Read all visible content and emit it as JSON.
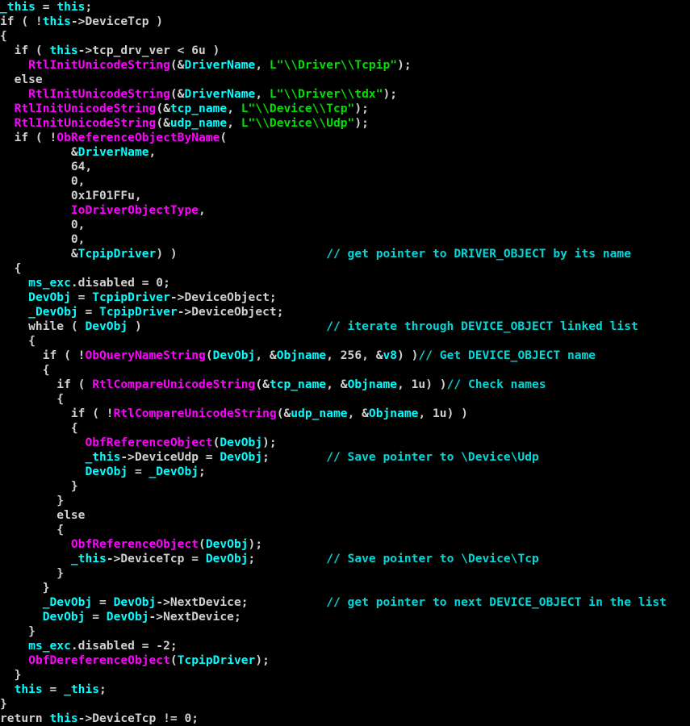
{
  "app": {
    "view_name": "Pseudocode",
    "background_color": "#000000"
  },
  "theme": {
    "background": "#000000",
    "default_text": "#d0d0d0",
    "keyword": "#d0d0d0",
    "identifier": "#00ffff",
    "function": "#ff00ff",
    "string": "#00e000",
    "comment": "#00d8d8",
    "number": "#d0d0d0"
  },
  "code": {
    "language": "c-pseudocode",
    "lines": [
      {
        "tokens": [
          {
            "t": "_this",
            "c": "var"
          },
          {
            "t": " ",
            "c": "plain"
          },
          {
            "t": "=",
            "c": "plain"
          },
          {
            "t": " ",
            "c": "plain"
          },
          {
            "t": "this",
            "c": "this"
          },
          {
            "t": ";",
            "c": "punct"
          }
        ]
      },
      {
        "tokens": [
          {
            "t": "if ( !",
            "c": "plain"
          },
          {
            "t": "this",
            "c": "this"
          },
          {
            "t": "->DeviceTcp )",
            "c": "plain"
          }
        ]
      },
      {
        "tokens": [
          {
            "t": "{",
            "c": "punct"
          }
        ]
      },
      {
        "tokens": [
          {
            "t": "  if ( ",
            "c": "plain"
          },
          {
            "t": "this",
            "c": "this"
          },
          {
            "t": "->tcp_drv_ver < 6u )",
            "c": "plain"
          }
        ]
      },
      {
        "tokens": [
          {
            "t": "    ",
            "c": "plain"
          },
          {
            "t": "RtlInitUnicodeString",
            "c": "func"
          },
          {
            "t": "(&",
            "c": "punct"
          },
          {
            "t": "DriverName",
            "c": "var"
          },
          {
            "t": ", ",
            "c": "punct"
          },
          {
            "t": "L\"\\\\Driver\\\\Tcpip\"",
            "c": "str"
          },
          {
            "t": ");",
            "c": "punct"
          }
        ]
      },
      {
        "tokens": [
          {
            "t": "  else",
            "c": "plain"
          }
        ]
      },
      {
        "tokens": [
          {
            "t": "    ",
            "c": "plain"
          },
          {
            "t": "RtlInitUnicodeString",
            "c": "func"
          },
          {
            "t": "(&",
            "c": "punct"
          },
          {
            "t": "DriverName",
            "c": "var"
          },
          {
            "t": ", ",
            "c": "punct"
          },
          {
            "t": "L\"\\\\Driver\\\\tdx\"",
            "c": "str"
          },
          {
            "t": ");",
            "c": "punct"
          }
        ]
      },
      {
        "tokens": [
          {
            "t": "  ",
            "c": "plain"
          },
          {
            "t": "RtlInitUnicodeString",
            "c": "func"
          },
          {
            "t": "(&",
            "c": "punct"
          },
          {
            "t": "tcp_name",
            "c": "var"
          },
          {
            "t": ", ",
            "c": "punct"
          },
          {
            "t": "L\"\\\\Device\\\\Tcp\"",
            "c": "str"
          },
          {
            "t": ");",
            "c": "punct"
          }
        ]
      },
      {
        "tokens": [
          {
            "t": "  ",
            "c": "plain"
          },
          {
            "t": "RtlInitUnicodeString",
            "c": "func"
          },
          {
            "t": "(&",
            "c": "punct"
          },
          {
            "t": "udp_name",
            "c": "var"
          },
          {
            "t": ", ",
            "c": "punct"
          },
          {
            "t": "L\"\\\\Device\\\\Udp\"",
            "c": "str"
          },
          {
            "t": ");",
            "c": "punct"
          }
        ]
      },
      {
        "tokens": [
          {
            "t": "  if ( !",
            "c": "plain"
          },
          {
            "t": "ObReferenceObjectByName",
            "c": "func"
          },
          {
            "t": "(",
            "c": "punct"
          }
        ]
      },
      {
        "tokens": [
          {
            "t": "          &",
            "c": "punct"
          },
          {
            "t": "DriverName",
            "c": "var"
          },
          {
            "t": ",",
            "c": "punct"
          }
        ]
      },
      {
        "tokens": [
          {
            "t": "          64,",
            "c": "num"
          }
        ]
      },
      {
        "tokens": [
          {
            "t": "          0,",
            "c": "num"
          }
        ]
      },
      {
        "tokens": [
          {
            "t": "          0x1F01FFu,",
            "c": "num"
          }
        ]
      },
      {
        "tokens": [
          {
            "t": "          ",
            "c": "plain"
          },
          {
            "t": "IoDriverObjectType",
            "c": "func"
          },
          {
            "t": ",",
            "c": "punct"
          }
        ]
      },
      {
        "tokens": [
          {
            "t": "          0,",
            "c": "num"
          }
        ]
      },
      {
        "tokens": [
          {
            "t": "          0,",
            "c": "num"
          }
        ]
      },
      {
        "tokens": [
          {
            "t": "          &",
            "c": "punct"
          },
          {
            "t": "TcpipDriver",
            "c": "var"
          },
          {
            "t": ") )",
            "c": "punct"
          }
        ],
        "comment": "// get pointer to DRIVER_OBJECT by its name",
        "comment_col": 46
      },
      {
        "tokens": [
          {
            "t": "  {",
            "c": "punct"
          }
        ]
      },
      {
        "tokens": [
          {
            "t": "    ",
            "c": "plain"
          },
          {
            "t": "ms_exc",
            "c": "var"
          },
          {
            "t": ".disabled = 0;",
            "c": "plain"
          }
        ]
      },
      {
        "tokens": [
          {
            "t": "    ",
            "c": "plain"
          },
          {
            "t": "DevObj",
            "c": "var"
          },
          {
            "t": " = ",
            "c": "plain"
          },
          {
            "t": "TcpipDriver",
            "c": "var"
          },
          {
            "t": "->DeviceObject;",
            "c": "plain"
          }
        ]
      },
      {
        "tokens": [
          {
            "t": "    ",
            "c": "plain"
          },
          {
            "t": "_DevObj",
            "c": "var"
          },
          {
            "t": " = ",
            "c": "plain"
          },
          {
            "t": "TcpipDriver",
            "c": "var"
          },
          {
            "t": "->DeviceObject;",
            "c": "plain"
          }
        ]
      },
      {
        "tokens": [
          {
            "t": "    while ( ",
            "c": "plain"
          },
          {
            "t": "DevObj",
            "c": "var"
          },
          {
            "t": " )",
            "c": "plain"
          }
        ],
        "comment": "// iterate through DEVICE_OBJECT linked list",
        "comment_col": 46
      },
      {
        "tokens": [
          {
            "t": "    {",
            "c": "punct"
          }
        ]
      },
      {
        "tokens": [
          {
            "t": "      if ( !",
            "c": "plain"
          },
          {
            "t": "ObQueryNameString",
            "c": "func"
          },
          {
            "t": "(",
            "c": "punct"
          },
          {
            "t": "DevObj",
            "c": "var"
          },
          {
            "t": ", &",
            "c": "punct"
          },
          {
            "t": "Objname",
            "c": "var"
          },
          {
            "t": ", 256, &",
            "c": "punct"
          },
          {
            "t": "v8",
            "c": "var"
          },
          {
            "t": ") )",
            "c": "punct"
          }
        ],
        "comment": "// Get DEVICE_OBJECT name",
        "comment_col": 0
      },
      {
        "tokens": [
          {
            "t": "      {",
            "c": "punct"
          }
        ]
      },
      {
        "tokens": [
          {
            "t": "        if ( ",
            "c": "plain"
          },
          {
            "t": "RtlCompareUnicodeString",
            "c": "func"
          },
          {
            "t": "(&",
            "c": "punct"
          },
          {
            "t": "tcp_name",
            "c": "var"
          },
          {
            "t": ", &",
            "c": "punct"
          },
          {
            "t": "Objname",
            "c": "var"
          },
          {
            "t": ", 1u) )",
            "c": "punct"
          }
        ],
        "comment": "// Check names",
        "comment_col": 0
      },
      {
        "tokens": [
          {
            "t": "        {",
            "c": "punct"
          }
        ]
      },
      {
        "tokens": [
          {
            "t": "          if ( !",
            "c": "plain"
          },
          {
            "t": "RtlCompareUnicodeString",
            "c": "func"
          },
          {
            "t": "(&",
            "c": "punct"
          },
          {
            "t": "udp_name",
            "c": "var"
          },
          {
            "t": ", &",
            "c": "punct"
          },
          {
            "t": "Objname",
            "c": "var"
          },
          {
            "t": ", 1u) )",
            "c": "punct"
          }
        ]
      },
      {
        "tokens": [
          {
            "t": "          {",
            "c": "punct"
          }
        ]
      },
      {
        "tokens": [
          {
            "t": "            ",
            "c": "plain"
          },
          {
            "t": "ObfReferenceObject",
            "c": "func"
          },
          {
            "t": "(",
            "c": "punct"
          },
          {
            "t": "DevObj",
            "c": "var"
          },
          {
            "t": ");",
            "c": "punct"
          }
        ]
      },
      {
        "tokens": [
          {
            "t": "            ",
            "c": "plain"
          },
          {
            "t": "_this",
            "c": "var"
          },
          {
            "t": "->DeviceUdp = ",
            "c": "plain"
          },
          {
            "t": "DevObj",
            "c": "var"
          },
          {
            "t": ";",
            "c": "punct"
          }
        ],
        "comment": "// Save pointer to \\Device\\Udp",
        "comment_col": 46
      },
      {
        "tokens": [
          {
            "t": "            ",
            "c": "plain"
          },
          {
            "t": "DevObj",
            "c": "var"
          },
          {
            "t": " = ",
            "c": "plain"
          },
          {
            "t": "_DevObj",
            "c": "var"
          },
          {
            "t": ";",
            "c": "punct"
          }
        ]
      },
      {
        "tokens": [
          {
            "t": "          }",
            "c": "punct"
          }
        ]
      },
      {
        "tokens": [
          {
            "t": "        }",
            "c": "punct"
          }
        ]
      },
      {
        "tokens": [
          {
            "t": "        else",
            "c": "plain"
          }
        ]
      },
      {
        "tokens": [
          {
            "t": "        {",
            "c": "punct"
          }
        ]
      },
      {
        "tokens": [
          {
            "t": "          ",
            "c": "plain"
          },
          {
            "t": "ObfReferenceObject",
            "c": "func"
          },
          {
            "t": "(",
            "c": "punct"
          },
          {
            "t": "DevObj",
            "c": "var"
          },
          {
            "t": ");",
            "c": "punct"
          }
        ]
      },
      {
        "tokens": [
          {
            "t": "          ",
            "c": "plain"
          },
          {
            "t": "_this",
            "c": "var"
          },
          {
            "t": "->DeviceTcp = ",
            "c": "plain"
          },
          {
            "t": "DevObj",
            "c": "var"
          },
          {
            "t": ";",
            "c": "punct"
          }
        ],
        "comment": "// Save pointer to \\Device\\Tcp",
        "comment_col": 46
      },
      {
        "tokens": [
          {
            "t": "        }",
            "c": "punct"
          }
        ]
      },
      {
        "tokens": [
          {
            "t": "      }",
            "c": "punct"
          }
        ]
      },
      {
        "tokens": [
          {
            "t": "      ",
            "c": "plain"
          },
          {
            "t": "_DevObj",
            "c": "var"
          },
          {
            "t": " = ",
            "c": "plain"
          },
          {
            "t": "DevObj",
            "c": "var"
          },
          {
            "t": "->NextDevice;",
            "c": "plain"
          }
        ],
        "comment": "// get pointer to next DEVICE_OBJECT in the list",
        "comment_col": 46
      },
      {
        "tokens": [
          {
            "t": "      ",
            "c": "plain"
          },
          {
            "t": "DevObj",
            "c": "var"
          },
          {
            "t": " = ",
            "c": "plain"
          },
          {
            "t": "DevObj",
            "c": "var"
          },
          {
            "t": "->NextDevice;",
            "c": "plain"
          }
        ]
      },
      {
        "tokens": [
          {
            "t": "    }",
            "c": "punct"
          }
        ]
      },
      {
        "tokens": [
          {
            "t": "    ",
            "c": "plain"
          },
          {
            "t": "ms_exc",
            "c": "var"
          },
          {
            "t": ".disabled = -2;",
            "c": "plain"
          }
        ]
      },
      {
        "tokens": [
          {
            "t": "    ",
            "c": "plain"
          },
          {
            "t": "ObfDereferenceObject",
            "c": "func"
          },
          {
            "t": "(",
            "c": "punct"
          },
          {
            "t": "TcpipDriver",
            "c": "var"
          },
          {
            "t": ");",
            "c": "punct"
          }
        ]
      },
      {
        "tokens": [
          {
            "t": "  }",
            "c": "punct"
          }
        ]
      },
      {
        "tokens": [
          {
            "t": "  ",
            "c": "plain"
          },
          {
            "t": "this",
            "c": "this"
          },
          {
            "t": " = ",
            "c": "plain"
          },
          {
            "t": "_this",
            "c": "var"
          },
          {
            "t": ";",
            "c": "punct"
          }
        ]
      },
      {
        "tokens": [
          {
            "t": "}",
            "c": "punct"
          }
        ]
      },
      {
        "tokens": [
          {
            "t": "return ",
            "c": "plain"
          },
          {
            "t": "this",
            "c": "this"
          },
          {
            "t": "->DeviceTcp != 0;",
            "c": "plain"
          }
        ]
      }
    ]
  }
}
